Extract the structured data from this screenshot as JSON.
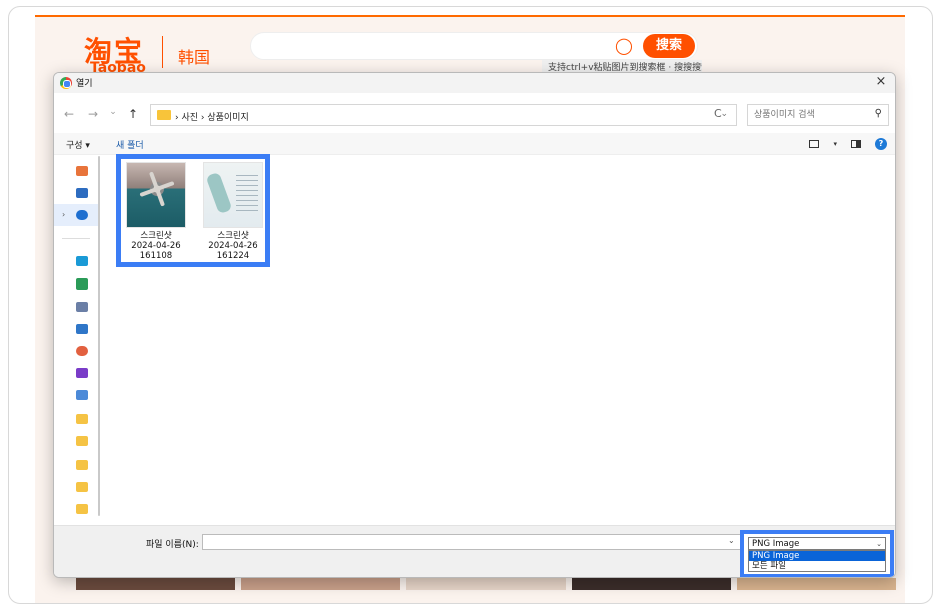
{
  "site": {
    "logo": "淘宝",
    "logo_sub": "Taobao",
    "region": "韩国",
    "search_button": "搜索",
    "search_hint": "支持ctrl+v粘贴图片到搜索框 · 搜搜搜索"
  },
  "dialog": {
    "title": "열기",
    "close_symbol": "×",
    "nav": {
      "back": "←",
      "forward": "→",
      "history": "⌄",
      "up": "↑"
    },
    "breadcrumbs": "›  사진  ›  상품이미지",
    "address_dropdown": "⌄",
    "refresh": "C",
    "search_placeholder": "상품이미지 검색",
    "search_icon": "search-icon",
    "toolbar": {
      "organize": "구성 ▾",
      "new_folder": "새 폴더",
      "view_dropdown": "▾",
      "help": "?"
    },
    "sidebar_icons": [
      "home-icon",
      "gallery-icon",
      "onedrive-icon",
      "desktop-icon",
      "downloads-icon",
      "documents-icon",
      "pictures-icon",
      "music-icon",
      "videos-icon",
      "image-folder-icon",
      "folder-icon",
      "folder-icon",
      "folder-icon",
      "folder-icon",
      "folder-icon"
    ],
    "sidebar_expand": "›",
    "files": [
      {
        "name": "스크린샷\n2024-04-26\n161108",
        "line1": "스크린샷",
        "line2": "2024-04-26",
        "line3": "161108"
      },
      {
        "name": "스크린샷\n2024-04-26\n161224",
        "line1": "스크린샷",
        "line2": "2024-04-26",
        "line3": "161224"
      }
    ],
    "filename_label": "파일 이름(N):",
    "filename_value": "",
    "filename_dropdown": "⌄",
    "file_type": {
      "selected": "PNG Image",
      "arrow": "⌄",
      "options": [
        "PNG Image",
        "모든 파일"
      ]
    }
  },
  "colors": {
    "accent": "#ff5000",
    "highlight": "#3b7df5",
    "selection": "#0a64d8"
  }
}
